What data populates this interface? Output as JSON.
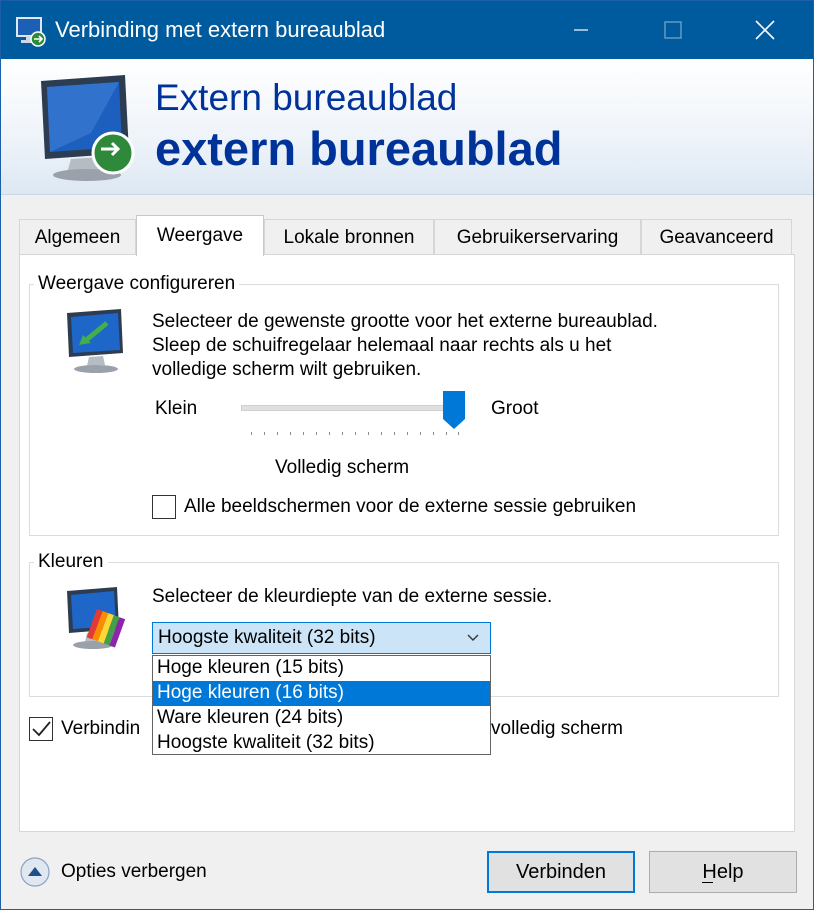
{
  "window": {
    "title": "Verbinding met extern bureaublad"
  },
  "banner": {
    "line1": "Extern bureaublad",
    "line2": "extern bureaublad"
  },
  "tabs": [
    {
      "label": "Algemeen",
      "active": false
    },
    {
      "label": "Weergave",
      "active": true
    },
    {
      "label": "Lokale bronnen",
      "active": false
    },
    {
      "label": "Gebruikerservaring",
      "active": false
    },
    {
      "label": "Geavanceerd",
      "active": false
    }
  ],
  "display_group": {
    "title": "Weergave configureren",
    "description_line1": "Selecteer de gewenste grootte voor het externe bureaublad.",
    "description_line2": "Sleep de schuifregelaar helemaal naar rechts als u het",
    "description_line3": "volledige scherm wilt gebruiken.",
    "slider_min_label": "Klein",
    "slider_max_label": "Groot",
    "slider_value": 1.0,
    "size_value": "Volledig scherm",
    "all_monitors_label": "Alle beeldschermen voor de externe sessie gebruiken",
    "all_monitors_checked": false
  },
  "colors_group": {
    "title": "Kleuren",
    "description": "Selecteer de kleurdiepte van de externe sessie.",
    "selected_value": "Hoogste kwaliteit (32 bits)",
    "options": [
      "Hoge kleuren (15 bits)",
      "Hoge kleuren (16 bits)",
      "Ware kleuren (24 bits)",
      "Hoogste kwaliteit (32 bits)"
    ],
    "highlighted_index": 1
  },
  "connection_bar": {
    "label_start": "Verbindin",
    "label_end": "volledig scherm",
    "checked": true
  },
  "footer": {
    "options_label": "Opties verbergen",
    "connect_label": "Verbinden",
    "help_label": "Help",
    "help_accesskey": "H"
  },
  "colors": {
    "titlebar": "#005a9e",
    "accent": "#0078d7",
    "banner_text": "#003399"
  }
}
